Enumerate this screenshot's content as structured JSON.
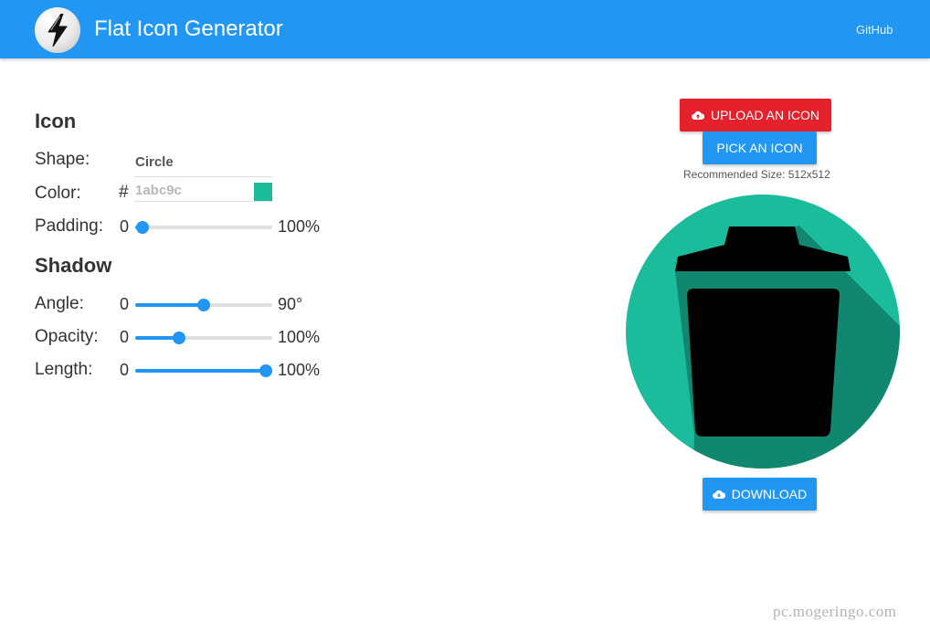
{
  "header": {
    "title": "Flat Icon Generator",
    "github_label": "GitHub",
    "logo_icon": "lightning-bolt-icon",
    "color": "#2196f3"
  },
  "icon_section": {
    "heading": "Icon",
    "shape": {
      "label": "Shape:",
      "value": "Circle"
    },
    "color": {
      "label": "Color:",
      "hash": "#",
      "value": "1abc9c",
      "swatch": "#1abc9c"
    },
    "padding": {
      "label": "Padding:",
      "min": "0",
      "max": "100%",
      "value_fraction": 0.05
    }
  },
  "shadow_section": {
    "heading": "Shadow",
    "angle": {
      "label": "Angle:",
      "min": "0",
      "max": "90°",
      "value_fraction": 0.5
    },
    "opacity": {
      "label": "Opacity:",
      "min": "0",
      "max": "100%",
      "value_fraction": 0.32
    },
    "length": {
      "label": "Length:",
      "min": "0",
      "max": "100%",
      "value_fraction": 0.95
    }
  },
  "actions": {
    "upload_label": "UPLOAD AN ICON",
    "upload_icon": "cloud-upload-icon",
    "upload_color": "#e5212d",
    "pick_label": "PICK AN ICON",
    "recommended": "Recommended Size: 512x512",
    "download_label": "DOWNLOAD",
    "download_icon": "cloud-download-icon"
  },
  "preview": {
    "icon": "trash-can-icon",
    "background": "#1abc9c",
    "shadow_color": "#12876f"
  },
  "watermark": "pc.mogeringo.com"
}
